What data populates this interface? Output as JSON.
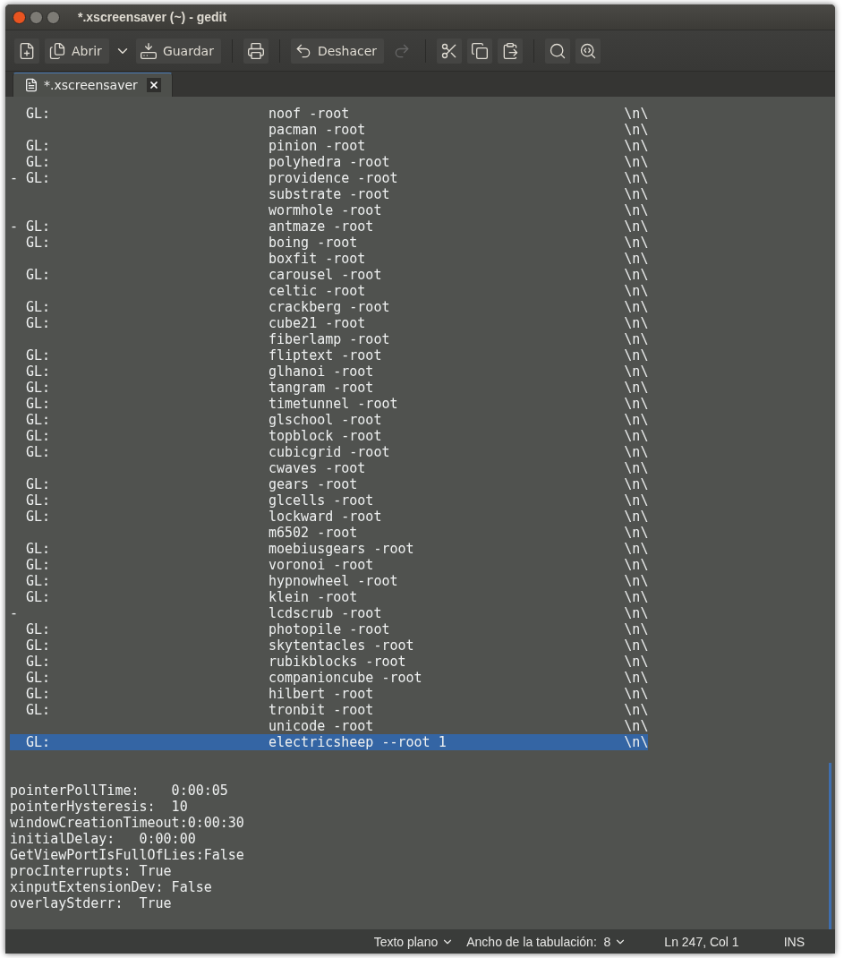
{
  "window": {
    "title": "*.xscreensaver (~) - gedit"
  },
  "toolbar": [
    {
      "kind": "new",
      "disabled": false
    },
    {
      "kind": "open",
      "label": "Abrir",
      "disabled": false
    },
    {
      "kind": "dropdown"
    },
    {
      "kind": "save",
      "label": "Guardar",
      "disabled": false
    },
    {
      "kind": "sep"
    },
    {
      "kind": "print",
      "disabled": false
    },
    {
      "kind": "sep"
    },
    {
      "kind": "undo",
      "label": "Deshacer",
      "disabled": false
    },
    {
      "kind": "redo",
      "disabled": true
    },
    {
      "kind": "sep"
    },
    {
      "kind": "cut",
      "disabled": false
    },
    {
      "kind": "copy",
      "disabled": false
    },
    {
      "kind": "paste",
      "disabled": false
    },
    {
      "kind": "sep"
    },
    {
      "kind": "find",
      "disabled": false
    },
    {
      "kind": "replace",
      "disabled": false
    }
  ],
  "tabs": [
    {
      "label": "*.xscreensaver",
      "selected": true
    }
  ],
  "programs": [
    {
      "marker": "  GL:",
      "command": "noof -root",
      "end": "\\n\\",
      "selected": false
    },
    {
      "command": "pacman -root",
      "end": "\\n\\",
      "selected": false
    },
    {
      "marker": "  GL:",
      "command": "pinion -root",
      "end": "\\n\\",
      "selected": false
    },
    {
      "marker": "  GL:",
      "command": "polyhedra -root",
      "end": "\\n\\",
      "selected": false
    },
    {
      "marker": "- GL:",
      "command": "providence -root",
      "end": "\\n\\",
      "selected": false
    },
    {
      "command": "substrate -root",
      "end": "\\n\\",
      "selected": false
    },
    {
      "command": "wormhole -root",
      "end": "\\n\\",
      "selected": false
    },
    {
      "marker": "- GL:",
      "command": "antmaze -root",
      "end": "\\n\\",
      "selected": false
    },
    {
      "marker": "  GL:",
      "command": "boing -root",
      "end": "\\n\\",
      "selected": false
    },
    {
      "command": "boxfit -root",
      "end": "\\n\\",
      "selected": false
    },
    {
      "marker": "  GL:",
      "command": "carousel -root",
      "end": "\\n\\",
      "selected": false
    },
    {
      "command": "celtic -root",
      "end": "\\n\\",
      "selected": false
    },
    {
      "marker": "  GL:",
      "command": "crackberg -root",
      "end": "\\n\\",
      "selected": false
    },
    {
      "marker": "  GL:",
      "command": "cube21 -root",
      "end": "\\n\\",
      "selected": false
    },
    {
      "command": "fiberlamp -root",
      "end": "\\n\\",
      "selected": false
    },
    {
      "marker": "  GL:",
      "command": "fliptext -root",
      "end": "\\n\\",
      "selected": false
    },
    {
      "marker": "  GL:",
      "command": "glhanoi -root",
      "end": "\\n\\",
      "selected": false
    },
    {
      "marker": "  GL:",
      "command": "tangram -root",
      "end": "\\n\\",
      "selected": false
    },
    {
      "marker": "  GL:",
      "command": "timetunnel -root",
      "end": "\\n\\",
      "selected": false
    },
    {
      "marker": "  GL:",
      "command": "glschool -root",
      "end": "\\n\\",
      "selected": false
    },
    {
      "marker": "  GL:",
      "command": "topblock -root",
      "end": "\\n\\",
      "selected": false
    },
    {
      "marker": "  GL:",
      "command": "cubicgrid -root",
      "end": "\\n\\",
      "selected": false
    },
    {
      "command": "cwaves -root",
      "end": "\\n\\",
      "selected": false
    },
    {
      "marker": "  GL:",
      "command": "gears -root",
      "end": "\\n\\",
      "selected": false
    },
    {
      "marker": "  GL:",
      "command": "glcells -root",
      "end": "\\n\\",
      "selected": false
    },
    {
      "marker": "  GL:",
      "command": "lockward -root",
      "end": "\\n\\",
      "selected": false
    },
    {
      "command": "m6502 -root",
      "end": "\\n\\",
      "selected": false
    },
    {
      "marker": "  GL:",
      "command": "moebiusgears -root",
      "end": "\\n\\",
      "selected": false
    },
    {
      "marker": "  GL:",
      "command": "voronoi -root",
      "end": "\\n\\",
      "selected": false
    },
    {
      "marker": "  GL:",
      "command": "hypnowheel -root",
      "end": "\\n\\",
      "selected": false
    },
    {
      "marker": "  GL:",
      "command": "klein -root",
      "end": "\\n\\",
      "selected": false
    },
    {
      "marker": "-",
      "command": "lcdscrub -root",
      "end": "\\n\\",
      "selected": false
    },
    {
      "marker": "  GL:",
      "command": "photopile -root",
      "end": "\\n\\",
      "selected": false
    },
    {
      "marker": "  GL:",
      "command": "skytentacles -root",
      "end": "\\n\\",
      "selected": false
    },
    {
      "marker": "  GL:",
      "command": "rubikblocks -root",
      "end": "\\n\\",
      "selected": false
    },
    {
      "marker": "  GL:",
      "command": "companioncube -root",
      "end": "\\n\\",
      "selected": false
    },
    {
      "marker": "  GL:",
      "command": "hilbert -root",
      "end": "\\n\\",
      "selected": false
    },
    {
      "marker": "  GL:",
      "command": "tronbit -root",
      "end": "\\n\\",
      "selected": false
    },
    {
      "command": "unicode -root",
      "end": "\\n\\",
      "selected": false
    },
    {
      "marker": "  GL:",
      "command": "electricsheep --root 1",
      "end": "\\n\\",
      "selected": true
    }
  ],
  "settings": [
    "pointerPollTime:    0:00:05",
    "pointerHysteresis:  10",
    "windowCreationTimeout:0:00:30",
    "initialDelay:   0:00:00",
    "GetViewPortIsFullOfLies:False",
    "procInterrupts: True",
    "xinputExtensionDev: False",
    "overlayStderr:  True"
  ],
  "status_bar": {
    "language": "Texto plano",
    "tab_width": "Ancho de la tabulación:  8",
    "position": "Ln 247, Col 1",
    "mode": "INS"
  }
}
